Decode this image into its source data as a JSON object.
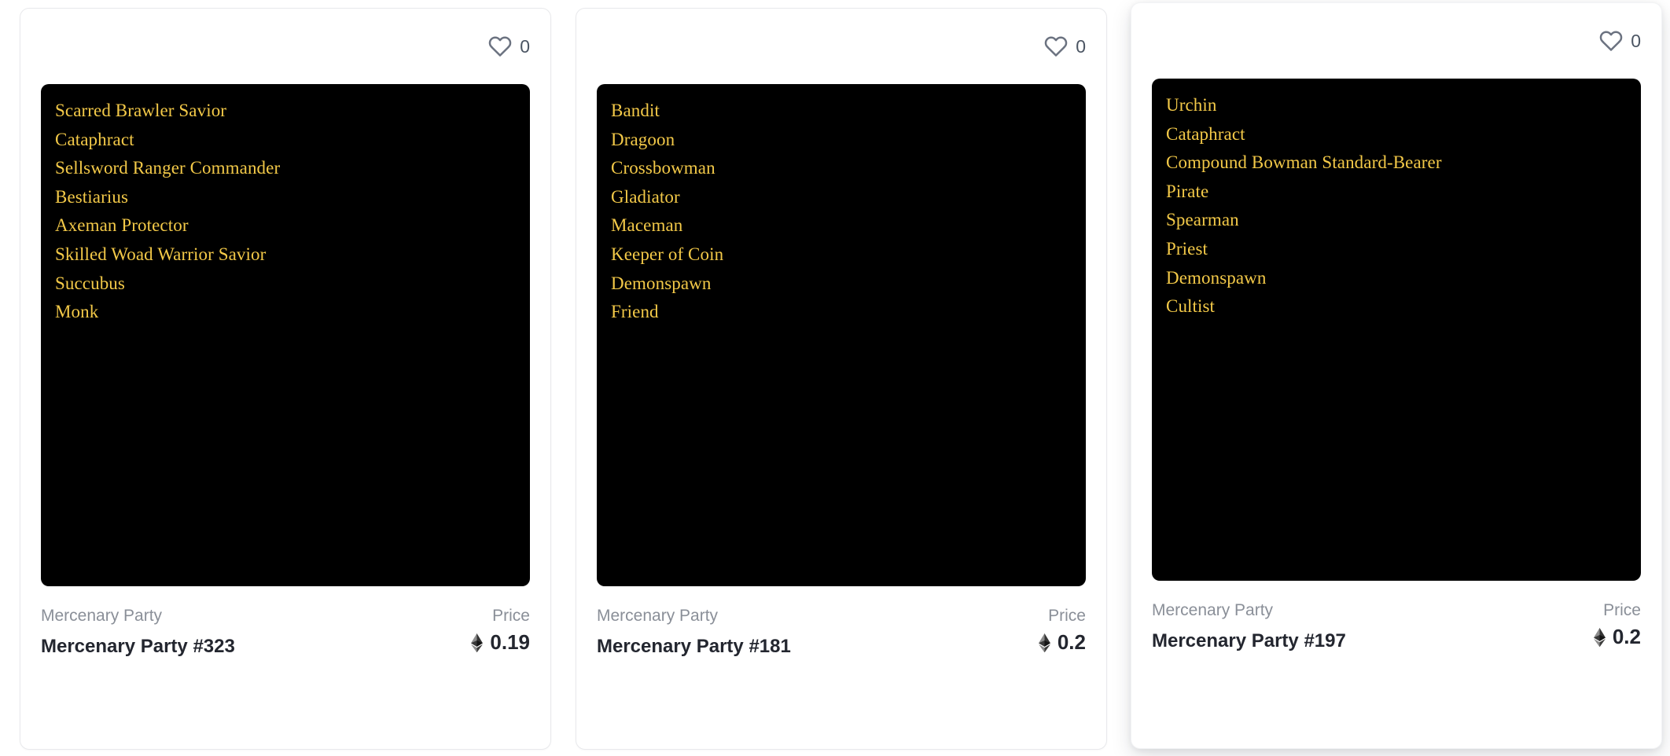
{
  "page": {
    "background_color": "#ffffff",
    "layout": "nft-card-grid",
    "card_count": 3
  },
  "theme": {
    "card_background": "#ffffff",
    "card_border": "#e8e9ec",
    "art_background": "#000000",
    "trait_text_color": "#f3c948",
    "muted_text_color": "#8a8f98",
    "title_text_color": "#23262f",
    "heart_color": "#6b7280"
  },
  "icons": {
    "heart": "heart-icon",
    "ethereum": "ethereum-icon"
  },
  "cards": [
    {
      "state": "resting",
      "like": {
        "icon": "heart-icon",
        "count": "0"
      },
      "traits": [
        "Scarred Brawler Savior",
        "Cataphract",
        "Sellsword Ranger Commander",
        "Bestiarius",
        "Axeman Protector",
        "Skilled Woad Warrior Savior",
        "Succubus",
        "Monk"
      ],
      "collection_label": "Mercenary Party",
      "title": "Mercenary Party #323",
      "price_label": "Price",
      "price_value": "0.19",
      "price_currency_icon": "ethereum-icon"
    },
    {
      "state": "resting",
      "like": {
        "icon": "heart-icon",
        "count": "0"
      },
      "traits": [
        "Bandit",
        "Dragoon",
        "Crossbowman",
        "Gladiator",
        "Maceman",
        "Keeper of Coin",
        "Demonspawn",
        "Friend"
      ],
      "collection_label": "Mercenary Party",
      "title": "Mercenary Party #181",
      "price_label": "Price",
      "price_value": "0.2",
      "price_currency_icon": "ethereum-icon"
    },
    {
      "state": "hovered",
      "like": {
        "icon": "heart-icon",
        "count": "0"
      },
      "traits": [
        "Urchin",
        "Cataphract",
        "Compound Bowman Standard-Bearer",
        "Pirate",
        "Spearman",
        "Priest",
        "Demonspawn",
        "Cultist"
      ],
      "collection_label": "Mercenary Party",
      "title": "Mercenary Party #197",
      "price_label": "Price",
      "price_value": "0.2",
      "price_currency_icon": "ethereum-icon"
    }
  ]
}
